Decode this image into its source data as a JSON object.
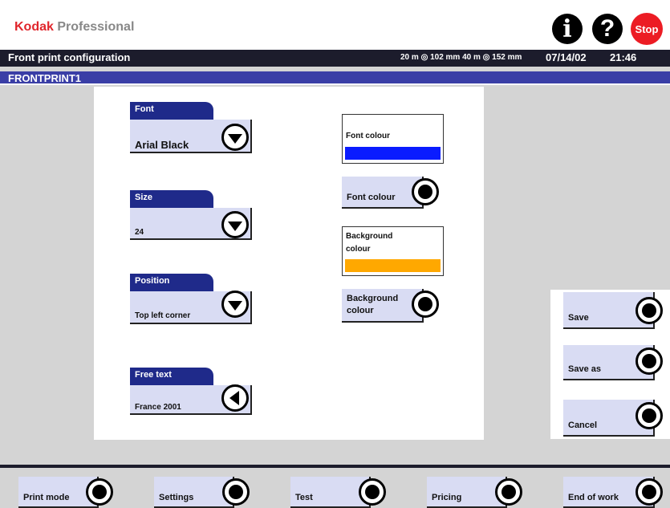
{
  "header": {
    "brand_kodak": "Kodak",
    "brand_professional": "Professional",
    "info_icon": "i",
    "help_icon": "?",
    "stop_label": "Stop"
  },
  "titlebar": {
    "screen_title": "Front print configuration",
    "media_info": "20 m ◎ 102 mm   40 m ◎ 152 mm",
    "date": "07/14/02",
    "time": "21:46"
  },
  "config_name": "FRONTPRINT1",
  "font": {
    "label": "Font",
    "value": "Arial Black"
  },
  "size": {
    "label": "Size",
    "value": "24"
  },
  "position": {
    "label": "Position",
    "value": "Top left corner"
  },
  "free_text": {
    "label": "Free text",
    "value": "France 2001"
  },
  "font_colour": {
    "swatch_label": "Font colour",
    "button_label": "Font colour",
    "color": "#0a1cff"
  },
  "background_colour": {
    "swatch_label": "Background colour",
    "button_label": "Background colour",
    "color": "#ffa800"
  },
  "side_actions": {
    "save": "Save",
    "save_as": "Save as",
    "cancel": "Cancel"
  },
  "bottom_nav": {
    "print_mode": "Print mode",
    "settings": "Settings",
    "test": "Test",
    "pricing": "Pricing",
    "end_of_work": "End of work"
  }
}
